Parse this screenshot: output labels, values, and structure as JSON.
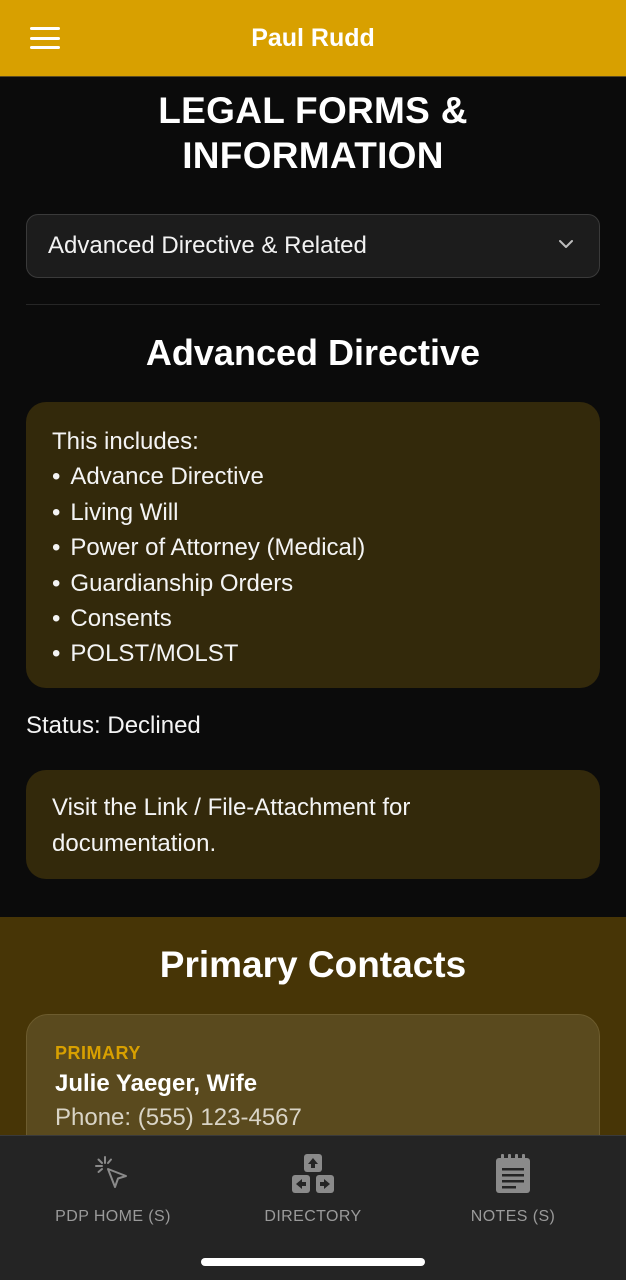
{
  "header": {
    "title": "Paul Rudd",
    "menu_icon": "hamburger-menu-icon"
  },
  "main": {
    "page_title_line1": "LEGAL FORMS &",
    "page_title_line2": "INFORMATION",
    "category_select": {
      "value": "Advanced Directive & Related"
    },
    "section_title": "Advanced Directive",
    "includes": {
      "intro": "This includes:",
      "items": [
        "Advance Directive",
        "Living Will",
        "Power of Attorney (Medical)",
        "Guardianship Orders",
        "Consents",
        "POLST/MOLST"
      ]
    },
    "status": "Status: Declined",
    "visit_note": "Visit the Link / File-Attachment for documentation."
  },
  "contacts": {
    "title": "Primary Contacts",
    "items": [
      {
        "role": "PRIMARY",
        "name": "Julie Yaeger,  Wife",
        "phone": "Phone: (555) 123-4567"
      }
    ]
  },
  "bottom_nav": {
    "items": [
      {
        "label": "PDP HOME (S)",
        "icon": "cursor-click-icon"
      },
      {
        "label": "DIRECTORY",
        "icon": "directory-arrows-icon"
      },
      {
        "label": "NOTES (S)",
        "icon": "notes-icon"
      }
    ]
  },
  "colors": {
    "accent": "#d8a000",
    "background": "#0b0b0b",
    "card": "#33290b",
    "contacts_bg": "#473506"
  }
}
